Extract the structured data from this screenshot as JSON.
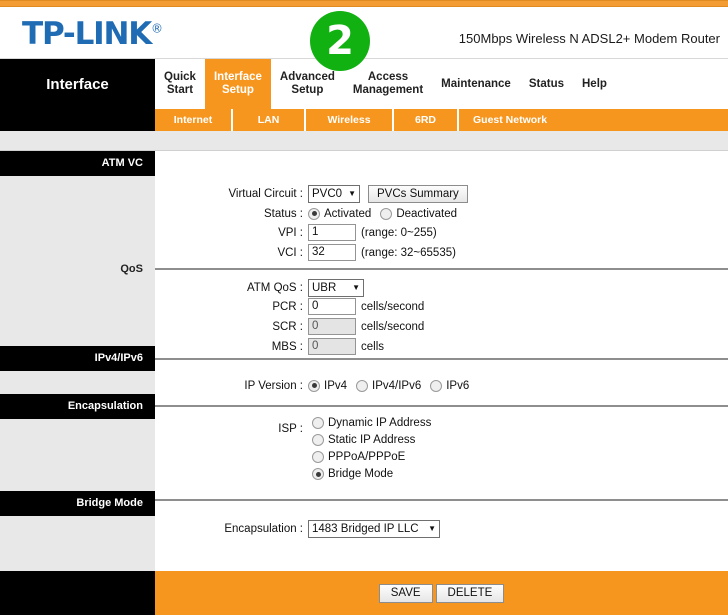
{
  "header": {
    "brand": "TP-LINK",
    "brand_reg": "®",
    "model": "150Mbps Wireless N ADSL2+ Modem Router",
    "annotation_badge": "2",
    "brand_color": "#1f6cb4",
    "accent_color": "#f7961e",
    "badge_color": "#12b112"
  },
  "nav": {
    "section_title": "Interface",
    "tabs": [
      {
        "label": "Quick\nStart",
        "active": false
      },
      {
        "label": "Interface\nSetup",
        "active": true
      },
      {
        "label": "Advanced\nSetup",
        "active": false
      },
      {
        "label": "Access\nManagement",
        "active": false
      },
      {
        "label": "Maintenance",
        "active": false
      },
      {
        "label": "Status",
        "active": false
      },
      {
        "label": "Help",
        "active": false
      }
    ],
    "subtabs": [
      {
        "label": "Internet",
        "active": true
      },
      {
        "label": "LAN",
        "active": false
      },
      {
        "label": "Wireless",
        "active": false
      },
      {
        "label": "6RD",
        "active": false
      },
      {
        "label": "Guest Network",
        "active": false
      }
    ]
  },
  "sections": {
    "atm_vc": "ATM VC",
    "qos": "QoS",
    "ipv4_ipv6": "IPv4/IPv6",
    "encapsulation": "Encapsulation",
    "bridge_mode": "Bridge Mode"
  },
  "atm_vc": {
    "virtual_circuit_label": "Virtual Circuit :",
    "virtual_circuit_value": "PVC0",
    "pvcs_summary_button": "PVCs Summary",
    "status_label": "Status :",
    "status_options": [
      {
        "label": "Activated",
        "selected": true
      },
      {
        "label": "Deactivated",
        "selected": false
      }
    ],
    "vpi_label": "VPI :",
    "vpi_value": "1",
    "vpi_hint": "(range: 0~255)",
    "vci_label": "VCI :",
    "vci_value": "32",
    "vci_hint": "(range: 32~65535)"
  },
  "qos": {
    "atm_qos_label": "ATM QoS :",
    "atm_qos_value": "UBR",
    "pcr_label": "PCR :",
    "pcr_value": "0",
    "pcr_unit": "cells/second",
    "scr_label": "SCR :",
    "scr_value": "0",
    "scr_unit": "cells/second",
    "mbs_label": "MBS :",
    "mbs_value": "0",
    "mbs_unit": "cells"
  },
  "ip_version": {
    "label": "IP Version :",
    "options": [
      {
        "label": "IPv4",
        "selected": true
      },
      {
        "label": "IPv4/IPv6",
        "selected": false
      },
      {
        "label": "IPv6",
        "selected": false
      }
    ]
  },
  "isp": {
    "label": "ISP :",
    "options": [
      {
        "label": "Dynamic IP Address",
        "selected": false
      },
      {
        "label": "Static IP Address",
        "selected": false
      },
      {
        "label": "PPPoA/PPPoE",
        "selected": false
      },
      {
        "label": "Bridge Mode",
        "selected": true
      }
    ]
  },
  "bridge": {
    "encapsulation_label": "Encapsulation :",
    "encapsulation_value": "1483 Bridged IP LLC"
  },
  "footer": {
    "save_label": "SAVE",
    "delete_label": "DELETE"
  }
}
